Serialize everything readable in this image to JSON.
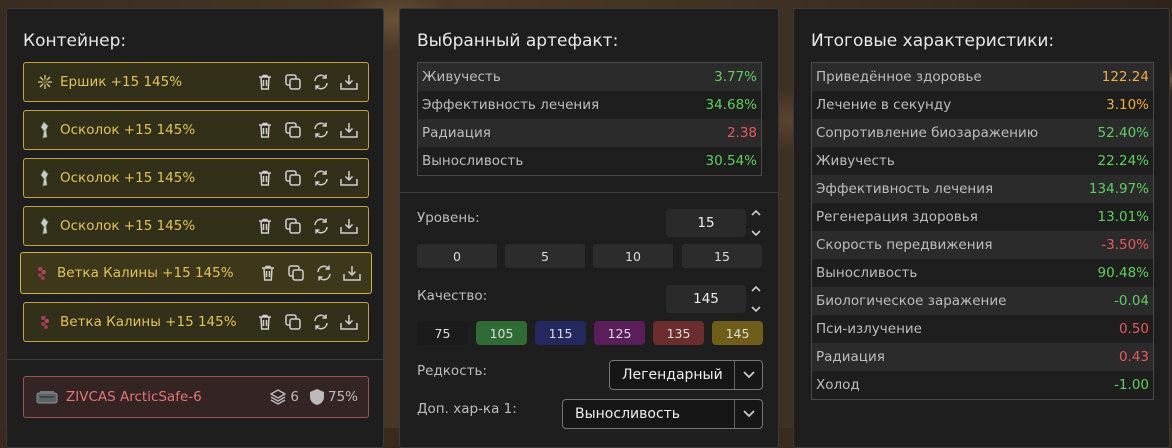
{
  "container": {
    "title": "Контейнер:",
    "items": [
      {
        "name": "Ершик +15 145%",
        "icon": "urchin-artifact-icon"
      },
      {
        "name": "Осколок +15 145%",
        "icon": "shard-artifact-icon"
      },
      {
        "name": "Осколок +15 145%",
        "icon": "shard-artifact-icon"
      },
      {
        "name": "Осколок +15 145%",
        "icon": "shard-artifact-icon"
      },
      {
        "name": "Ветка Калины +15 145%",
        "icon": "viburnum-artifact-icon"
      },
      {
        "name": "Ветка Калины +15 145%",
        "icon": "viburnum-artifact-icon"
      }
    ],
    "selected_index": 4,
    "case": {
      "name": "ZIVCAS ArcticSafe-6",
      "slots": "6",
      "protection": "75%"
    }
  },
  "artifact": {
    "title": "Выбранный артефакт:",
    "stats": [
      {
        "k": "Живучесть",
        "v": "3.77%",
        "c": "g"
      },
      {
        "k": "Эффективность лечения",
        "v": "34.68%",
        "c": "g"
      },
      {
        "k": "Радиация",
        "v": "2.38",
        "c": "r"
      },
      {
        "k": "Выносливость",
        "v": "30.54%",
        "c": "g"
      }
    ],
    "level_label": "Уровень:",
    "level_value": "15",
    "level_presets": [
      "0",
      "5",
      "10",
      "15"
    ],
    "quality_label": "Качество:",
    "quality_value": "145",
    "quality_presets": [
      {
        "v": "75",
        "bg": "#1b1b1b"
      },
      {
        "v": "105",
        "bg": "#2f6b34"
      },
      {
        "v": "115",
        "bg": "#23295e"
      },
      {
        "v": "125",
        "bg": "#5a1f5a"
      },
      {
        "v": "135",
        "bg": "#6b2d2d"
      },
      {
        "v": "145",
        "bg": "#6e5e18"
      }
    ],
    "rarity_label": "Редкость:",
    "rarity_value": "Легендарный",
    "extra_label": "Доп. хар-ка 1:",
    "extra_value": "Выносливость"
  },
  "totals": {
    "title": "Итоговые характеристики:",
    "stats": [
      {
        "k": "Приведённое здоровье",
        "v": "122.24",
        "c": "o"
      },
      {
        "k": "Лечение в секунду",
        "v": "3.10%",
        "c": "o"
      },
      {
        "k": "Сопротивление биозаражению",
        "v": "52.40%",
        "c": "g"
      },
      {
        "k": "Живучесть",
        "v": "22.24%",
        "c": "g"
      },
      {
        "k": "Эффективность лечения",
        "v": "134.97%",
        "c": "g"
      },
      {
        "k": "Регенерация здоровья",
        "v": "13.01%",
        "c": "g"
      },
      {
        "k": "Скорость передвижения",
        "v": "-3.50%",
        "c": "r"
      },
      {
        "k": "Выносливость",
        "v": "90.48%",
        "c": "g"
      },
      {
        "k": "Биологическое заражение",
        "v": "-0.04",
        "c": "g"
      },
      {
        "k": "Пси-излучение",
        "v": "0.50",
        "c": "r"
      },
      {
        "k": "Радиация",
        "v": "0.43",
        "c": "r"
      },
      {
        "k": "Холод",
        "v": "-1.00",
        "c": "g"
      }
    ]
  }
}
